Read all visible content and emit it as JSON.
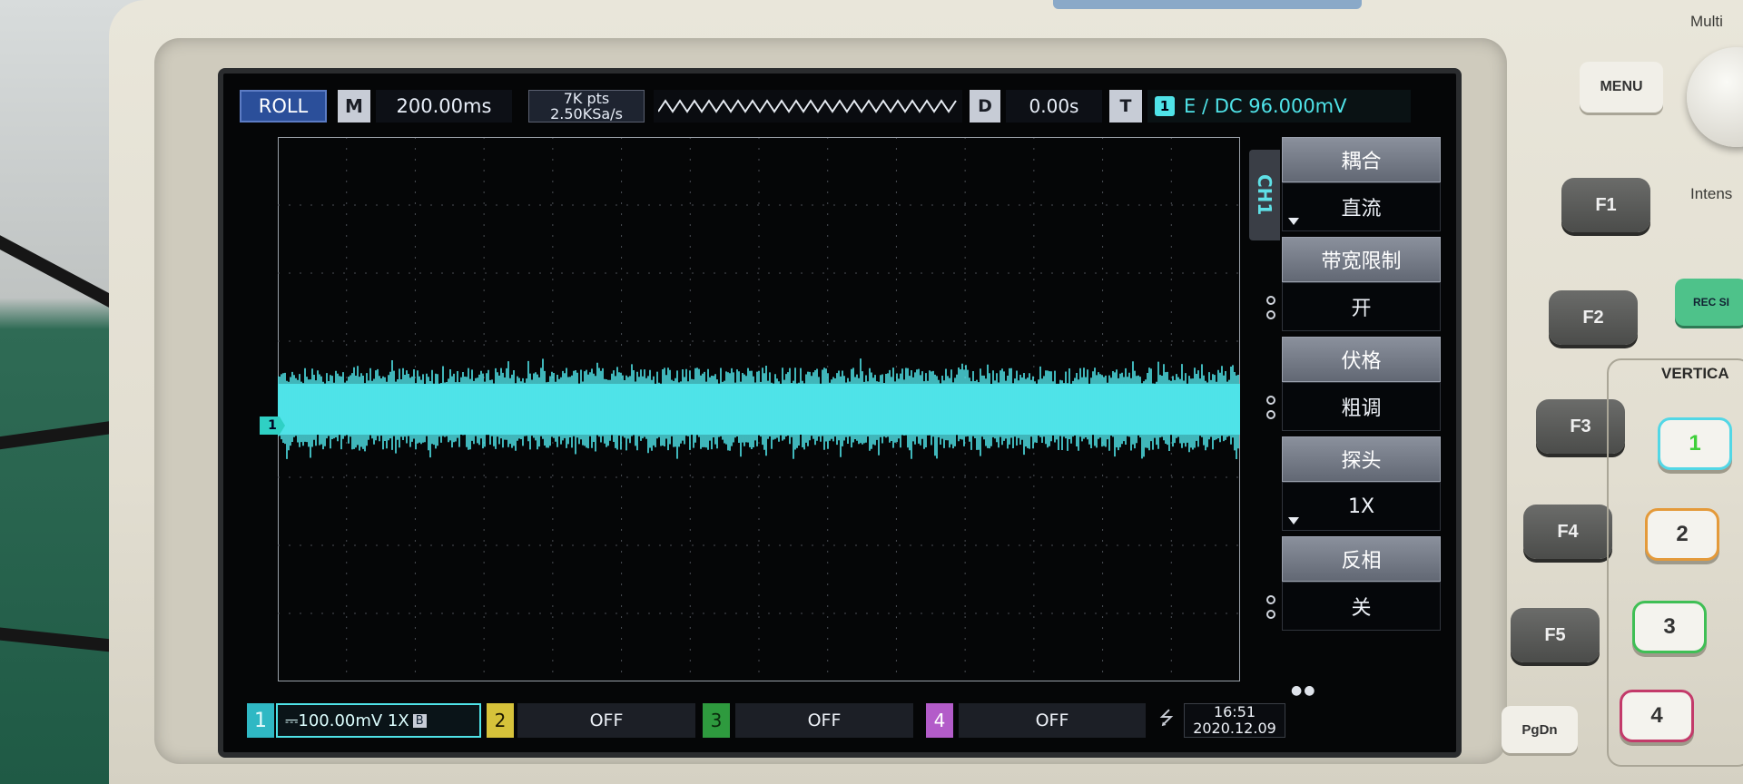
{
  "topbar": {
    "mode": "ROLL",
    "menu_m": "M",
    "timebase": "200.00ms",
    "mem_depth": "7K pts",
    "sample_rate": "2.50KSa/s",
    "delay_label": "D",
    "delay_value": "0.00s",
    "trigger_label": "T",
    "trigger_channel": "1",
    "trigger_info": "E ∕ DC 96.000mV"
  },
  "menu": {
    "channel_tab": "CH1",
    "items": [
      {
        "header": "耦合",
        "value": "直流"
      },
      {
        "header": "带宽限制",
        "value": "开"
      },
      {
        "header": "伏格",
        "value": "粗调"
      },
      {
        "header": "探头",
        "value": "1X"
      },
      {
        "header": "反相",
        "value": "关"
      }
    ]
  },
  "waveform": {
    "channel_marker": "1",
    "color": "#4fe3e8"
  },
  "bottombar": {
    "ch1_num": "1",
    "ch1_setting": "⎓100.00mV 1X",
    "ch1_bw": "B",
    "ch2_num": "2",
    "ch2_state": "OFF",
    "ch3_num": "3",
    "ch3_state": "OFF",
    "ch4_num": "4",
    "ch4_state": "OFF",
    "usb_icon": "usb-icon",
    "time": "16:51",
    "date": "2020.12.09"
  },
  "panel": {
    "menu_button": "MENU",
    "f_keys": [
      "F1",
      "F2",
      "F3",
      "F4",
      "F5"
    ],
    "pgdn": "PgDn",
    "multi_label": "Multi",
    "intensity_label": "Intens",
    "rec_label": "REC SI",
    "vertical_label": "VERTICA",
    "channel_buttons": [
      "1",
      "2",
      "3",
      "4"
    ],
    "channel_colors": [
      "#52d7e6",
      "#e49a3a",
      "#3fbf55",
      "#c33a6a"
    ]
  }
}
